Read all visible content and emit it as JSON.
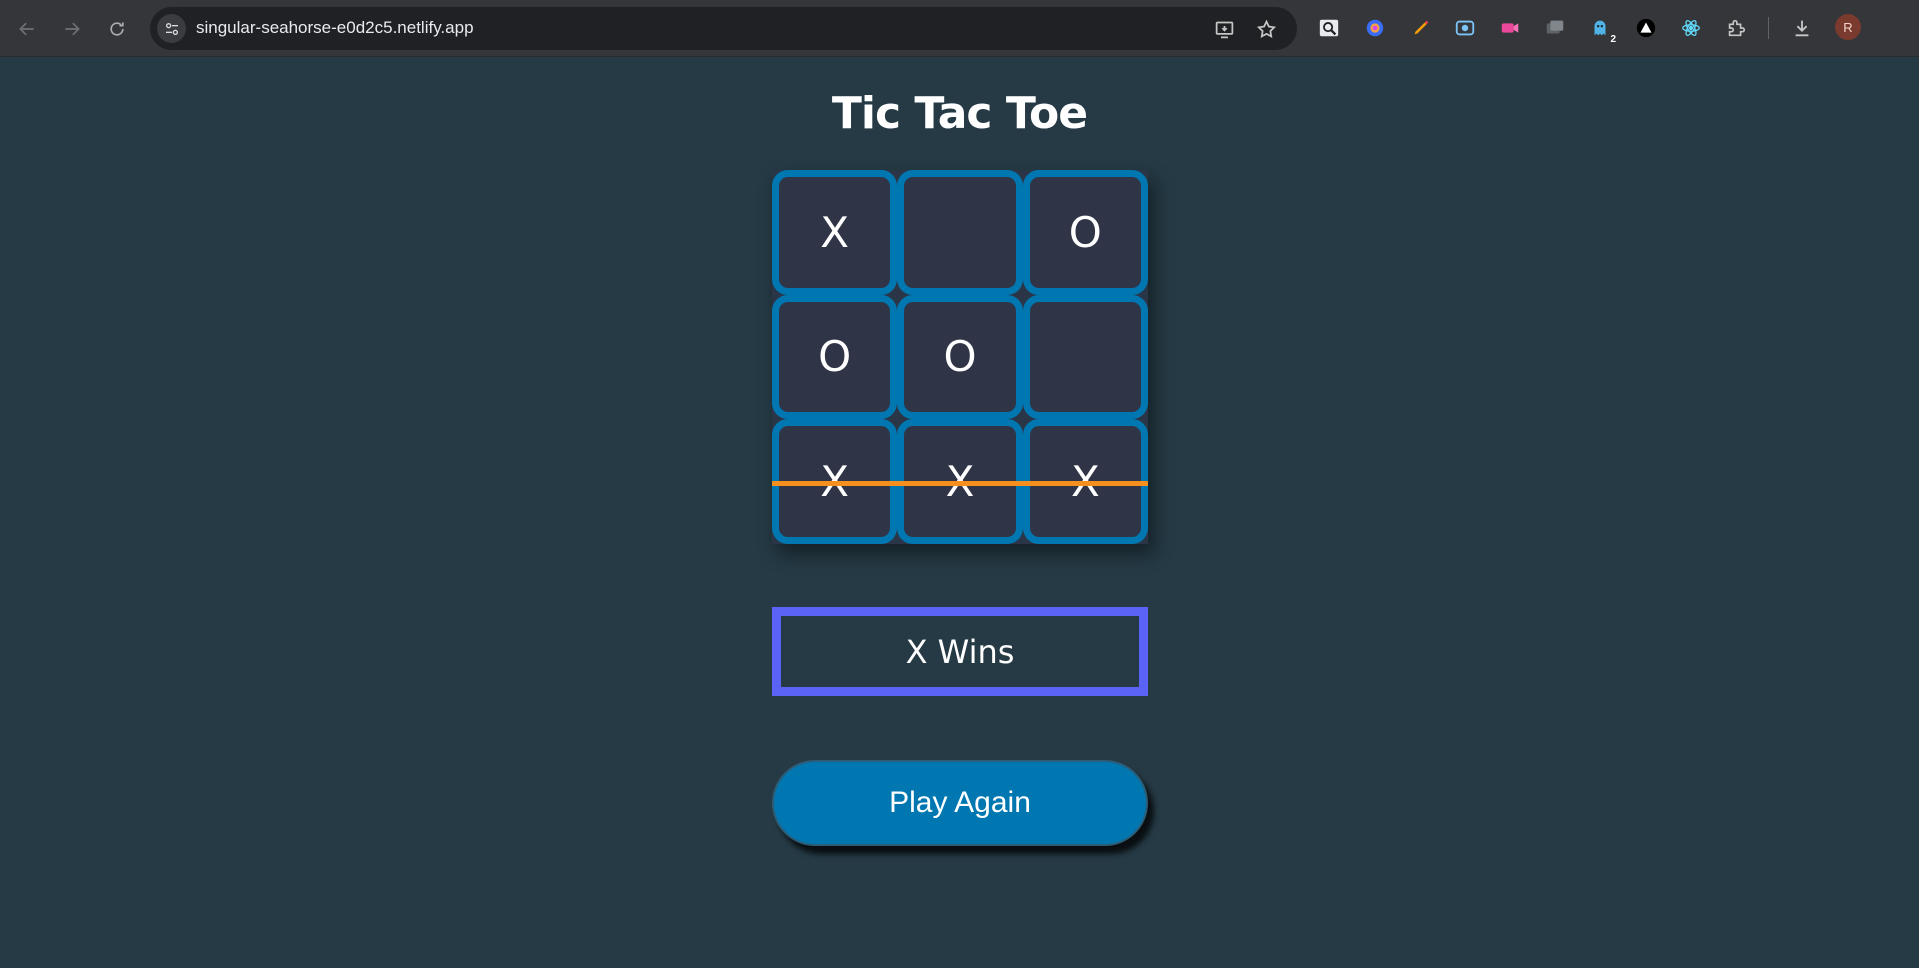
{
  "browser": {
    "url": "singular-seahorse-e0d2c5.netlify.app",
    "profile_initial": "R",
    "extension_badge": "2",
    "icons": [
      "back-arrow-icon",
      "forward-arrow-icon",
      "reload-icon",
      "site-info-icon",
      "install-app-icon",
      "bookmark-star-icon",
      "extensions-puzzle-icon",
      "download-icon"
    ]
  },
  "game": {
    "title": "Tic Tac Toe",
    "board": [
      [
        "X",
        "",
        "O"
      ],
      [
        "O",
        "O",
        ""
      ],
      [
        "X",
        "X",
        "X"
      ]
    ],
    "winning_row": 3,
    "status": "X Wins",
    "play_again_label": "Play Again"
  },
  "colors": {
    "background": "#253a45",
    "cell_border": "#0077b0",
    "cell_fill": "#2f3447",
    "win_line": "#f5901e",
    "status_border": "#5a63f5",
    "button": "#0077b0"
  }
}
